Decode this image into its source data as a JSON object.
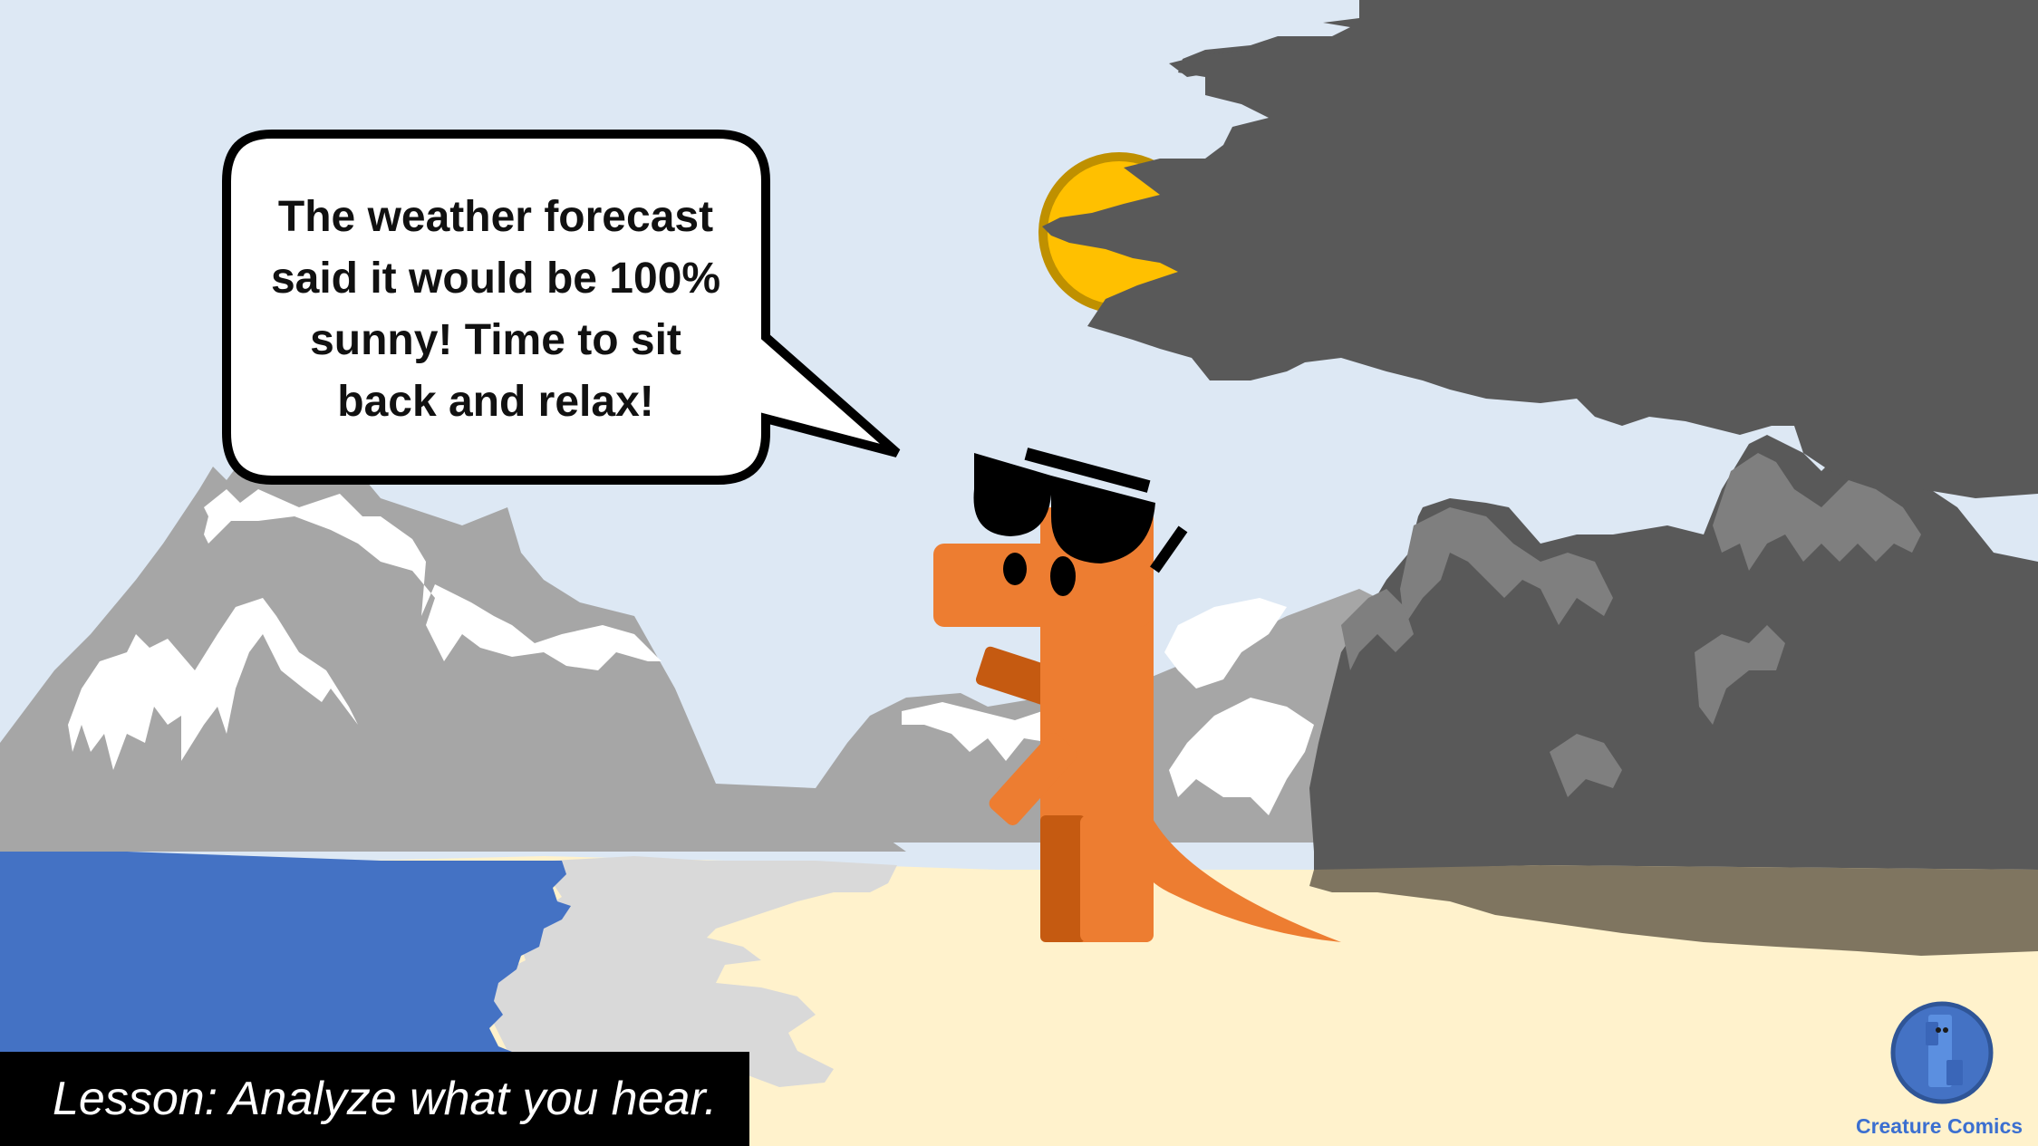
{
  "speech_bubble": {
    "line1": "The weather forecast",
    "line2": "said it would be 100%",
    "line3": "sunny! Time to sit",
    "line4": "back and relax!"
  },
  "lesson": {
    "text": "Lesson: Analyze what you hear."
  },
  "brand": {
    "name": "Creature Comics",
    "logo_icon": "dino-logo-icon"
  },
  "colors": {
    "sky": "#dde8f4",
    "sand": "#fff2cc",
    "water": "#4472c4",
    "mountain": "#a6a6a6",
    "storm_cloud": "#595959",
    "dino": "#ed7d31",
    "dino_dark": "#c55a11",
    "sun": "#ffc000"
  }
}
